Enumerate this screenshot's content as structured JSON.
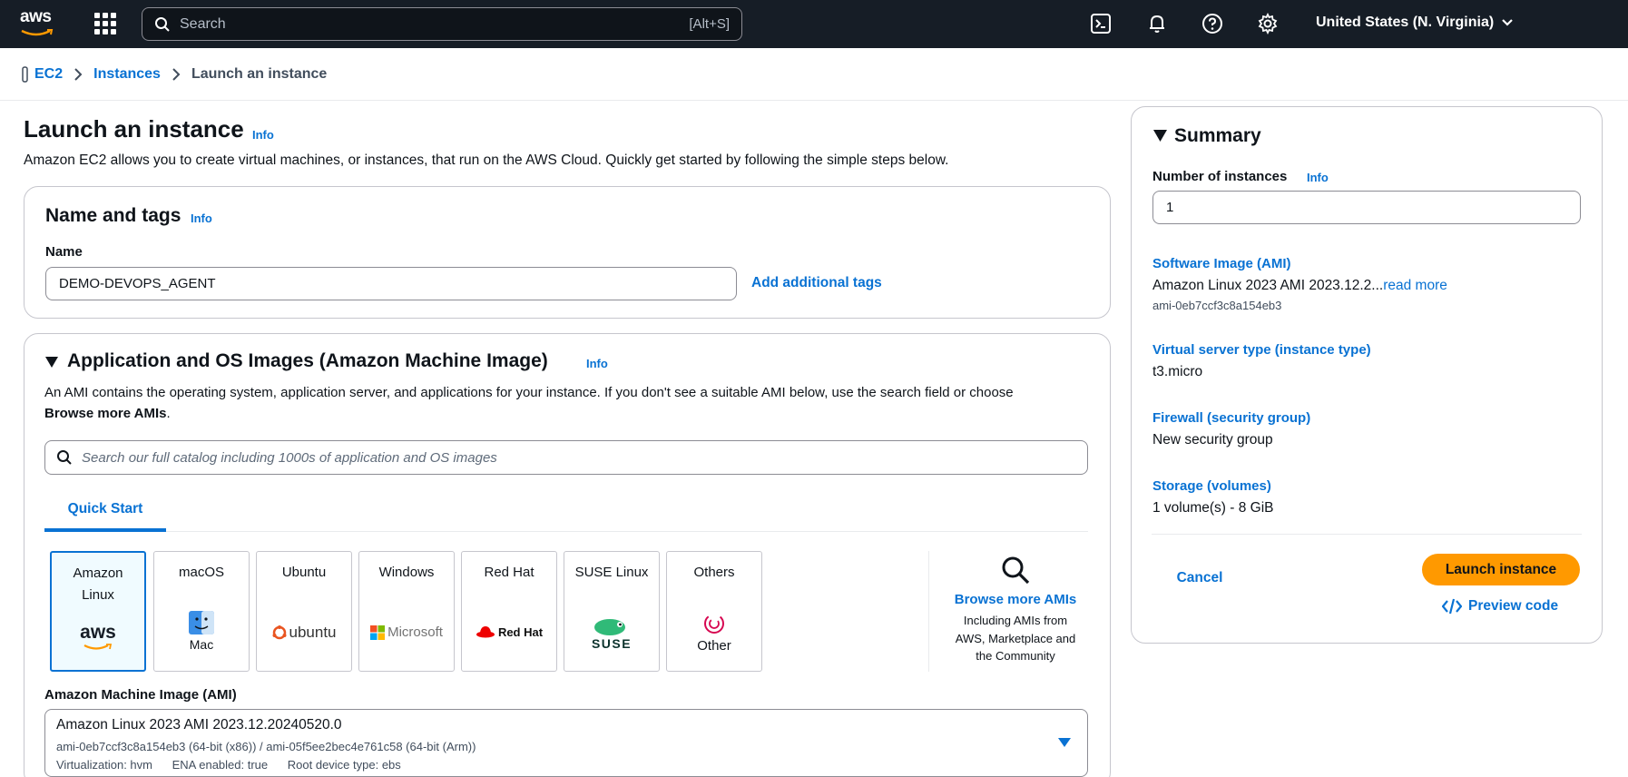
{
  "topnav": {
    "logo_text": "aws",
    "search_placeholder": "Search",
    "search_shortcut": "[Alt+S]",
    "region": "United States (N. Virginia)",
    "icons": [
      "services-grid-icon",
      "search-icon",
      "cloudshell-icon",
      "bell-icon",
      "help-icon",
      "gear-icon",
      "chevron-down-icon"
    ]
  },
  "breadcrumb": {
    "items": [
      "EC2",
      "Instances"
    ],
    "current": "Launch an instance"
  },
  "page": {
    "title": "Launch an instance",
    "info": "Info",
    "description": "Amazon EC2 allows you to create virtual machines, or instances, that run on the AWS Cloud. Quickly get started by following the simple steps below."
  },
  "name_tags": {
    "title": "Name and tags",
    "info": "Info",
    "name_label": "Name",
    "name_value": "DEMO-DEVOPS_AGENT",
    "add_tags": "Add additional tags"
  },
  "ami": {
    "title": "Application and OS Images (Amazon Machine Image)",
    "info": "Info",
    "description_1": "An AMI contains the operating system, application server, and applications for your instance. If you don't see a suitable AMI below, use the search field or choose",
    "description_2": "Browse more AMIs",
    "description_3": ".",
    "search_placeholder": "Search our full catalog including 1000s of application and OS images",
    "tab": "Quick Start",
    "tiles": [
      {
        "label": "Amazon Linux",
        "logo": "aws"
      },
      {
        "label": "macOS",
        "logo": "Mac"
      },
      {
        "label": "Ubuntu",
        "logo": "ubuntu"
      },
      {
        "label": "Windows",
        "logo": "Microsoft"
      },
      {
        "label": "Red Hat",
        "logo": "Red Hat"
      },
      {
        "label": "SUSE Linux",
        "logo": "SUSE"
      },
      {
        "label": "Others",
        "logo": "Other"
      }
    ],
    "browse_link": "Browse more AMIs",
    "browse_desc": [
      "Including AMIs from",
      "AWS, Marketplace and",
      "the Community"
    ],
    "select_label": "Amazon Machine Image (AMI)",
    "selected": {
      "name": "Amazon Linux 2023 AMI 2023.12.20240520.0",
      "ids": "ami-0eb7ccf3c8a154eb3 (64-bit (x86)) / ami-05f5ee2bec4e761c58 (64-bit (Arm))",
      "virtualization": "Virtualization: hvm",
      "ena": "ENA enabled: true",
      "root": "Root device type: ebs"
    }
  },
  "summary": {
    "title": "Summary",
    "instances_label": "Number of instances",
    "info": "Info",
    "instances_value": "1",
    "software_label": "Software Image (AMI)",
    "software_value": "Amazon Linux 2023 AMI 2023.12.2...",
    "read_more": "read more",
    "software_id": "ami-0eb7ccf3c8a154eb3",
    "type_label": "Virtual server type (instance type)",
    "type_value": "t3.micro",
    "firewall_label": "Firewall (security group)",
    "firewall_value": "New security group",
    "storage_label": "Storage (volumes)",
    "storage_value": "1 volume(s) - 8 GiB",
    "cancel": "Cancel",
    "launch": "Launch instance",
    "preview": "Preview code"
  },
  "colors": {
    "nav_bg": "#161d26",
    "link": "#0972d3",
    "launch": "#ff9900",
    "border": "#c6c6cd"
  }
}
